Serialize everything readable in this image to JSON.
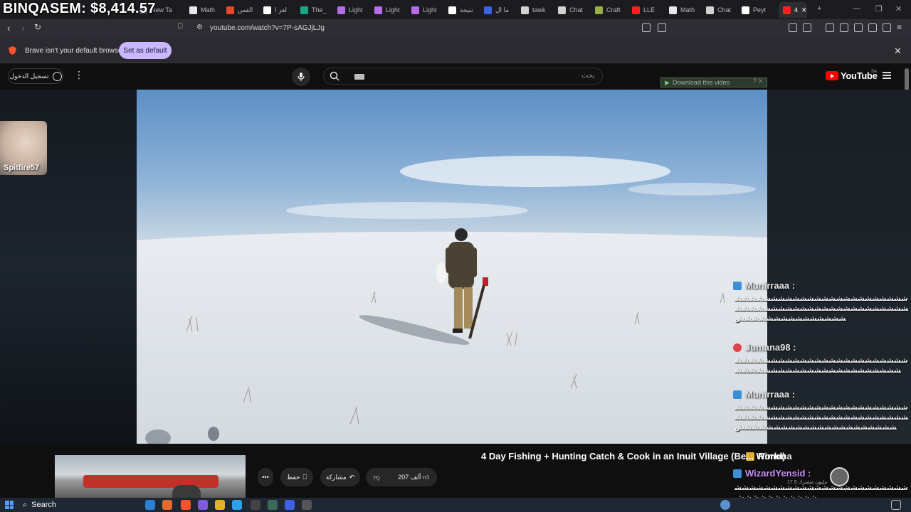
{
  "overlay": {
    "channel_label": "BINQASEM:",
    "amount": "$8,414.57"
  },
  "tabs": [
    {
      "label": "New Tab",
      "color": "#5b5b66"
    },
    {
      "label": "Math",
      "color": "#e8e8ea"
    },
    {
      "label": "القس",
      "color": "#e54a2f"
    },
    {
      "label": "لغز ا",
      "color": "#ffffff"
    },
    {
      "label": "The_",
      "color": "#18a689"
    },
    {
      "label": "Light",
      "color": "#b46fe8"
    },
    {
      "label": "Light",
      "color": "#b46fe8"
    },
    {
      "label": "Light",
      "color": "#b46fe8"
    },
    {
      "label": "نتيجة",
      "color": "#ffffff"
    },
    {
      "label": "ما ال",
      "color": "#3b63e6"
    },
    {
      "label": "tawk",
      "color": "#d2d2d2"
    },
    {
      "label": "Chat",
      "color": "#d2d2d2"
    },
    {
      "label": "Craft",
      "color": "#9ab04a"
    },
    {
      "label": "LLE",
      "color": "#ff2020"
    },
    {
      "label": "Math",
      "color": "#e8e8ea"
    },
    {
      "label": "Chat",
      "color": "#d2d2d2"
    },
    {
      "label": "Peyt",
      "color": "#ffffff"
    },
    {
      "label": "4",
      "color": "#ff2020"
    }
  ],
  "address_bar": {
    "url": "youtube.com/watch?v=7P-sAGJjLJg"
  },
  "infobar": {
    "message": "Brave isn't your default browser",
    "button": "Set as default"
  },
  "youtube": {
    "sign_in": "تسجيل الدخول",
    "search_placeholder": "بحث",
    "logo": "YouTube",
    "region": "SA",
    "download_label": "Download this video",
    "download_extra": "? X"
  },
  "webcam": {
    "name": "Spitfire57"
  },
  "chat": [
    {
      "user": "Munirraaa :",
      "badge": "blue",
      "body": "ششششششششششششششششششششششششششششششششششششششششششششششششششششششششششششششش"
    },
    {
      "user": "Jumana98 :",
      "badge": "rose",
      "body": "شششششششششششششششششششششششششششششششششششششششششششششششش"
    },
    {
      "user": "Munirraaa :",
      "badge": "blue",
      "body": "شششششششششششششششششششششششششششششششششششششششششششششششششششششششششششششششششششششش"
    },
    {
      "user": "Rimona",
      "badge": "blue",
      "body": ""
    },
    {
      "user": "WizardYensid :",
      "badge": "blue",
      "body": "ششششششششششششششششششششششششششششششششششش"
    }
  ],
  "video": {
    "title": "4 Day Fishing + Hunting Catch & Cook in an Inuit Village (Be... World)"
  },
  "actions": {
    "like": "207 ألف",
    "share": "مشاركة",
    "save": "حفظ",
    "more": "•••"
  },
  "channel": {
    "subs": "17.9 مليون مشترك"
  },
  "taskbar": {
    "search": "Search"
  }
}
